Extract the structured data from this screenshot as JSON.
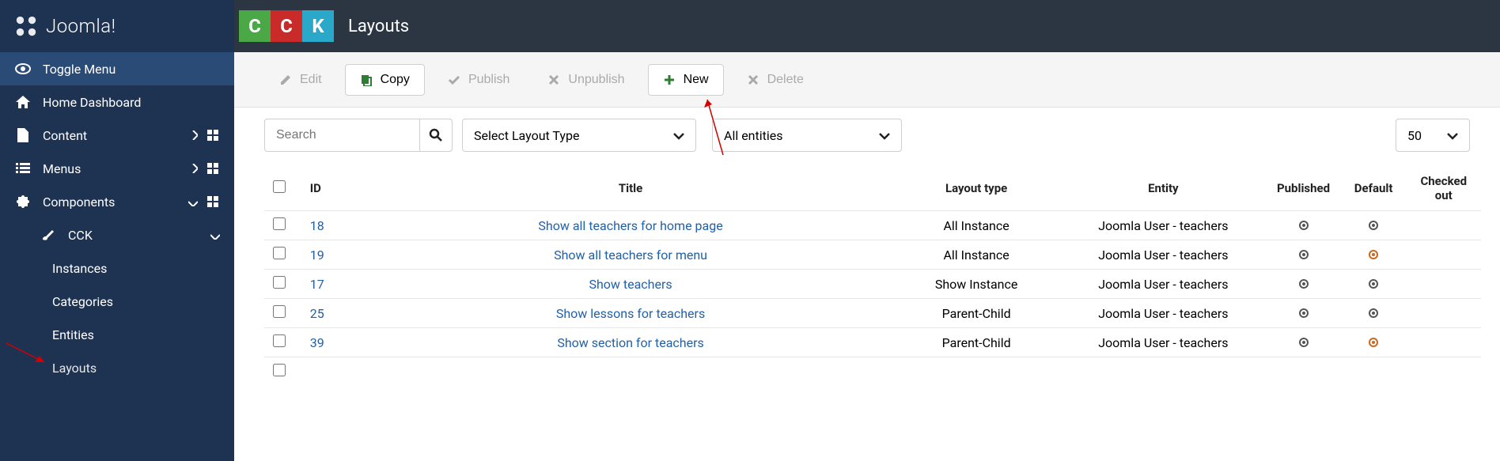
{
  "brand": "Joomla!",
  "page_title": "Layouts",
  "cck_tiles": [
    {
      "letter": "C",
      "bg": "#4aa847"
    },
    {
      "letter": "C",
      "bg": "#c92a2a"
    },
    {
      "letter": "K",
      "bg": "#2aa8c9"
    }
  ],
  "sidebar": {
    "toggle": "Toggle Menu",
    "home": "Home Dashboard",
    "content": "Content",
    "menus": "Menus",
    "components": "Components",
    "cck": "CCK",
    "instances": "Instances",
    "categories": "Categories",
    "entities": "Entities",
    "layouts": "Layouts"
  },
  "toolbar": {
    "edit": "Edit",
    "copy": "Copy",
    "publish": "Publish",
    "unpublish": "Unpublish",
    "new": "New",
    "delete": "Delete"
  },
  "filters": {
    "search_placeholder": "Search",
    "layout_type": "Select Layout Type",
    "entity": "All entities",
    "limit": "50"
  },
  "columns": {
    "id": "ID",
    "title": "Title",
    "layout_type": "Layout type",
    "entity": "Entity",
    "published": "Published",
    "default": "Default",
    "checked_out": "Checked out"
  },
  "rows": [
    {
      "id": "18",
      "title": "Show all teachers for home page",
      "type": "All Instance",
      "entity": "Joomla User - teachers",
      "default_variant": "dark"
    },
    {
      "id": "19",
      "title": "Show all teachers for menu",
      "type": "All Instance",
      "entity": "Joomla User - teachers",
      "default_variant": "orange"
    },
    {
      "id": "17",
      "title": "Show teachers",
      "type": "Show Instance",
      "entity": "Joomla User - teachers",
      "default_variant": "dark"
    },
    {
      "id": "25",
      "title": "Show lessons for teachers",
      "type": "Parent-Child",
      "entity": "Joomla User - teachers",
      "default_variant": "dark"
    },
    {
      "id": "39",
      "title": "Show section for teachers",
      "type": "Parent-Child",
      "entity": "Joomla User - teachers",
      "default_variant": "orange"
    }
  ]
}
